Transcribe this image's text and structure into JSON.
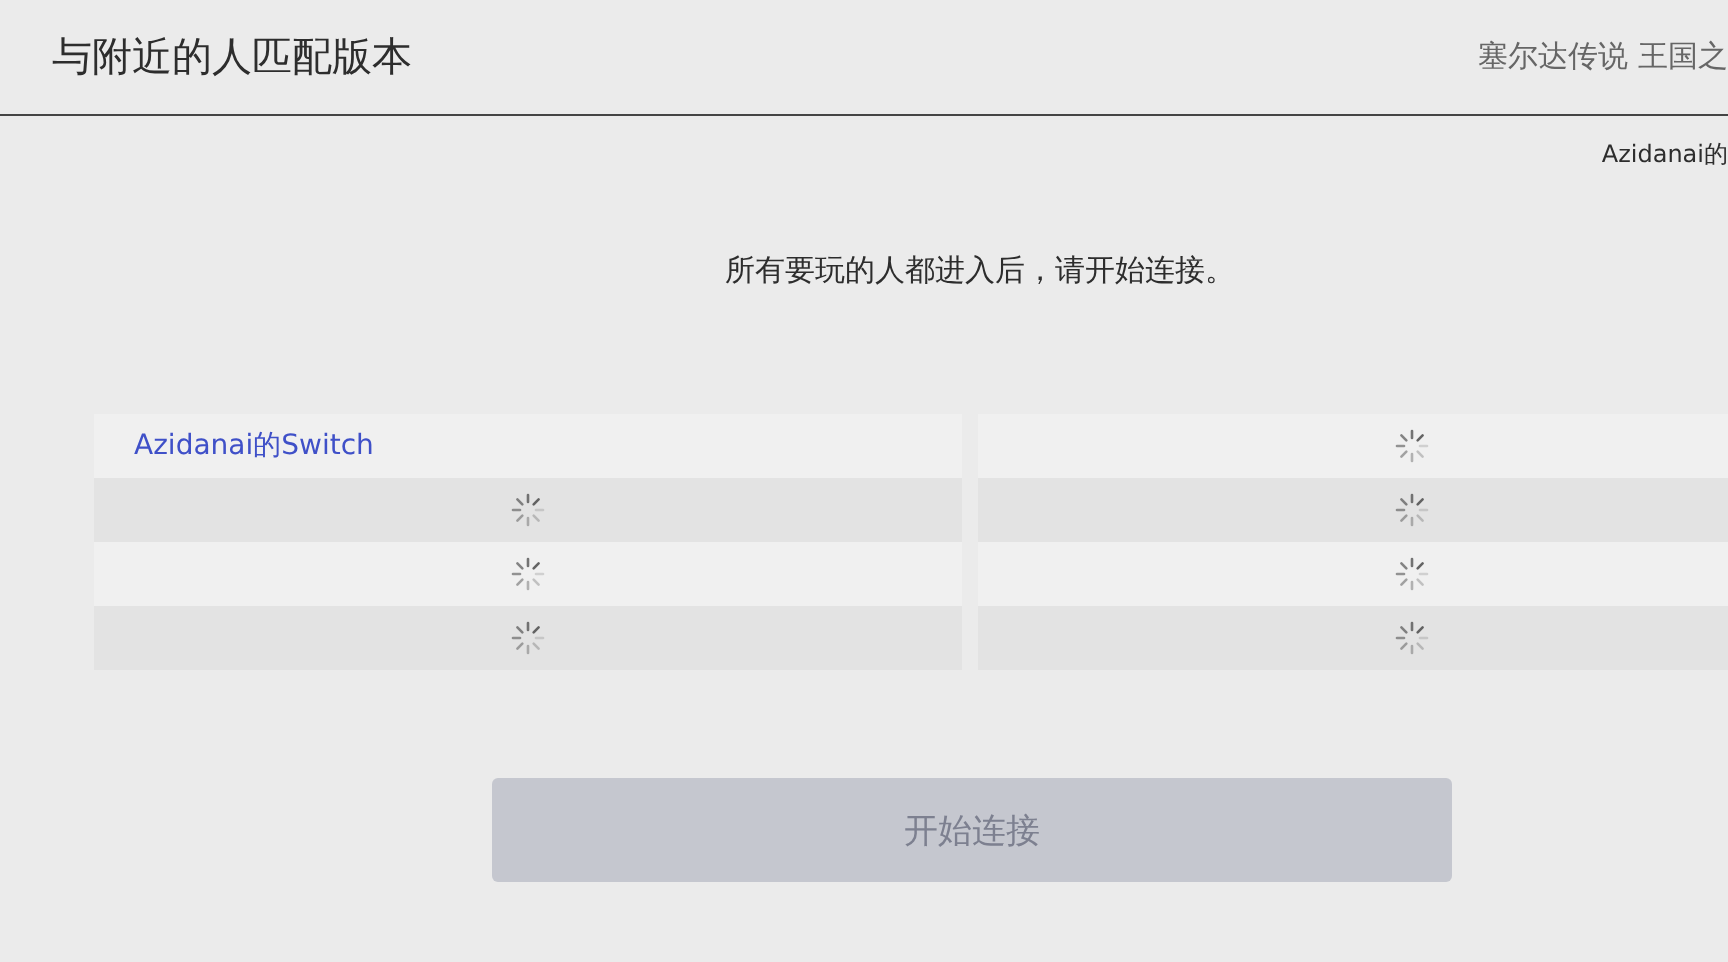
{
  "header": {
    "title": "与附近的人匹配版本",
    "game": "塞尔达传说 王国之"
  },
  "host_label": "Azidanai的",
  "message": "所有要玩的人都进入后，请开始连接。",
  "slots": [
    {
      "kind": "player",
      "name": "Azidanai的Switch"
    },
    {
      "kind": "waiting"
    },
    {
      "kind": "waiting"
    },
    {
      "kind": "waiting"
    },
    {
      "kind": "waiting"
    },
    {
      "kind": "waiting"
    },
    {
      "kind": "waiting"
    },
    {
      "kind": "waiting"
    }
  ],
  "start_button": {
    "label": "开始连接",
    "disabled": true
  }
}
